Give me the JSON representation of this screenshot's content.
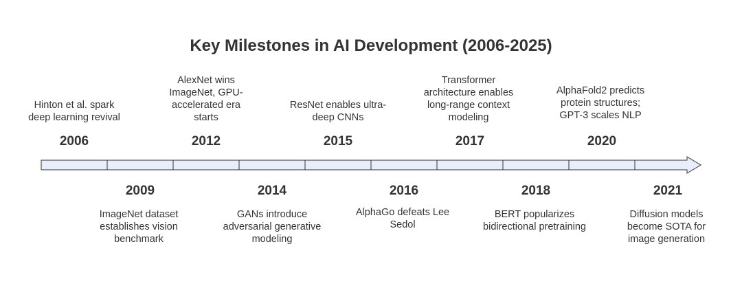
{
  "title": "Key Milestones in AI Development (2006-2025)",
  "colors": {
    "arrow_fill": "#e8eefb",
    "arrow_stroke": "#333333",
    "text": "#333333"
  },
  "milestones": [
    {
      "year": "2006",
      "description": "Hinton et al. spark deep learning revival",
      "position": "above"
    },
    {
      "year": "2009",
      "description": "ImageNet dataset establishes vision benchmark",
      "position": "below"
    },
    {
      "year": "2012",
      "description": "AlexNet wins ImageNet, GPU-accelerated era starts",
      "position": "above"
    },
    {
      "year": "2014",
      "description": "GANs introduce adversarial generative modeling",
      "position": "below"
    },
    {
      "year": "2015",
      "description": "ResNet enables ultra-deep CNNs",
      "position": "above"
    },
    {
      "year": "2016",
      "description": "AlphaGo defeats Lee Sedol",
      "position": "below"
    },
    {
      "year": "2017",
      "description": "Transformer architecture enables long-range context modeling",
      "position": "above"
    },
    {
      "year": "2018",
      "description": "BERT popularizes bidirectional pretraining",
      "position": "below"
    },
    {
      "year": "2020",
      "description": "AlphaFold2 predicts protein structures; GPT-3 scales NLP",
      "position": "above"
    },
    {
      "year": "2021",
      "description": "Diffusion models become SOTA for image generation",
      "position": "below"
    }
  ]
}
